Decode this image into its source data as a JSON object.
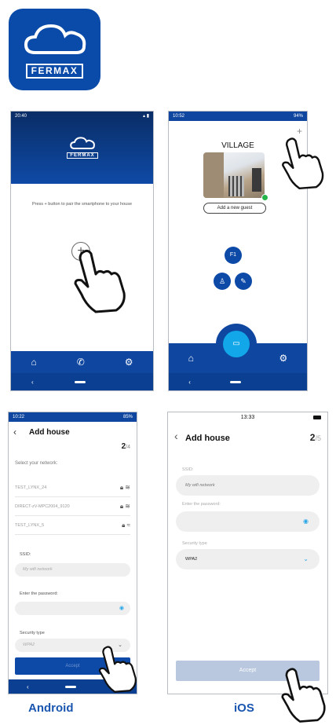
{
  "app_icon": {
    "logo_text": "blue",
    "brand": "FERMAX",
    "bg_color": "#0a4aa8"
  },
  "android_home": {
    "time": "20:40",
    "logo_text": "blue",
    "brand": "FERMAX",
    "pair_text": "Press + button to pair the smartphone to your house",
    "plus_label": "+",
    "nav": [
      "home-icon",
      "phone-icon",
      "gear-icon"
    ]
  },
  "android_house": {
    "time": "10:52",
    "battery": "94%",
    "house_name": "VILLAGE",
    "add_guest": "Add a new guest",
    "f1_label": "F1",
    "plus_label": "+"
  },
  "android_add_house": {
    "time": "10:22",
    "battery": "85%",
    "title": "Add house",
    "step_current": "2",
    "step_total": "/4",
    "select_network_label": "Select your network:",
    "networks": [
      {
        "ssid": "TEST_LYNX_24"
      },
      {
        "ssid": "DIRECT-zV-MPC2004_9120"
      },
      {
        "ssid": "TEST_LYNX_5"
      }
    ],
    "ssid_label": "SSID:",
    "ssid_placeholder": "My wifi network",
    "password_label": "Enter the password:",
    "security_label": "Security type",
    "security_value": "WPA2",
    "accept": "Accept"
  },
  "ios_add_house": {
    "time": "13:33",
    "title": "Add house",
    "step_current": "2",
    "step_total": "/5",
    "ssid_label": "SSID:",
    "ssid_value": "My wifi network",
    "password_label": "Enter the password:",
    "security_label": "Security type",
    "security_value": "WPA2",
    "accept": "Accept"
  },
  "labels": {
    "android": "Android",
    "ios": "iOS"
  },
  "colors": {
    "brand_blue": "#0e46a0",
    "accent_cyan": "#12a7e8",
    "label_blue": "#1a56b0"
  }
}
